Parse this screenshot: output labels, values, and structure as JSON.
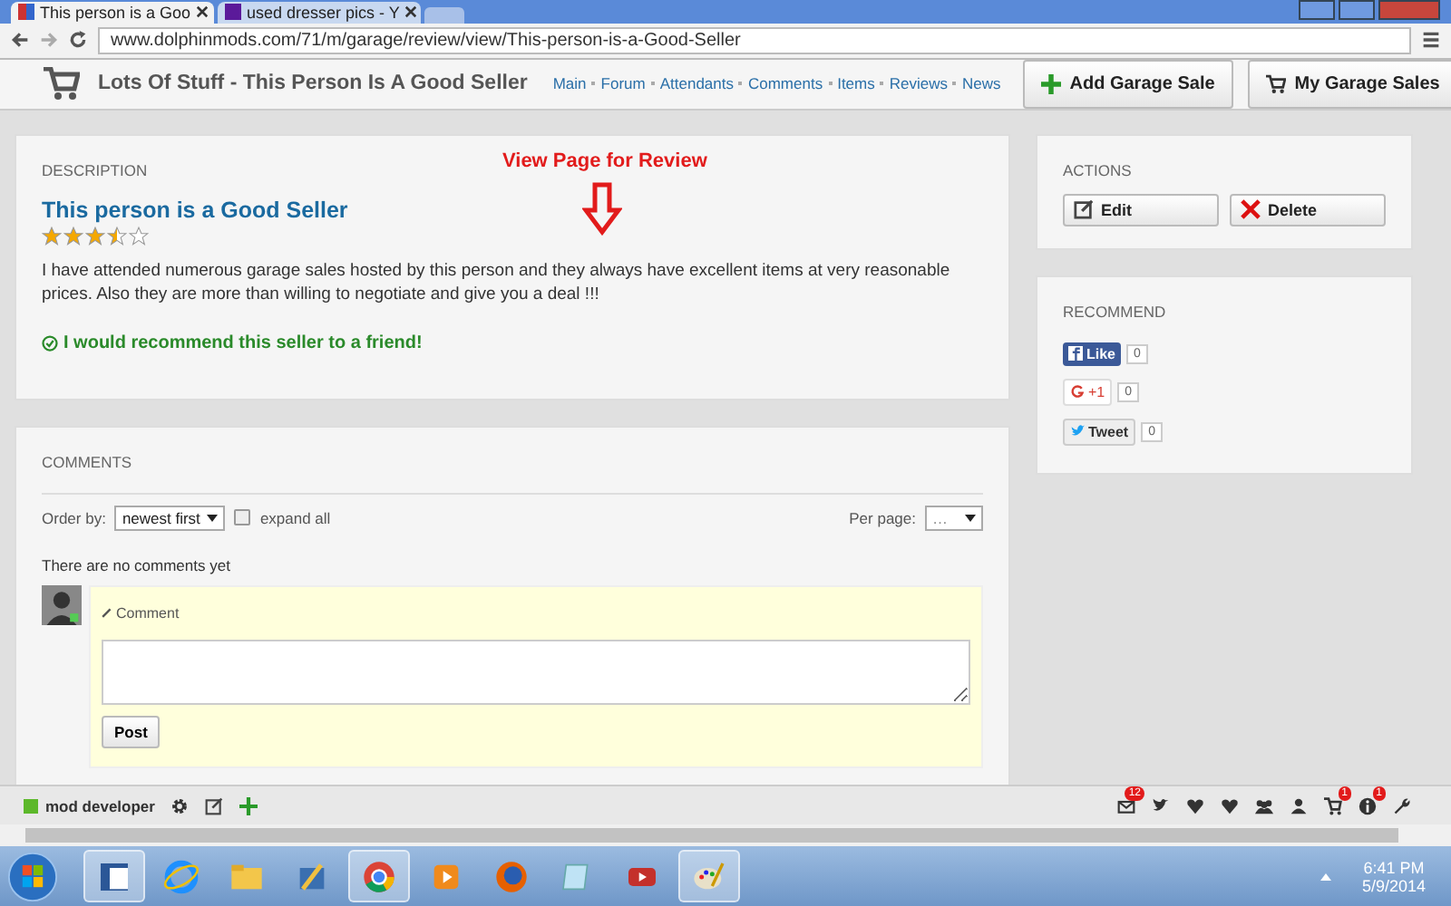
{
  "browser": {
    "tabs": [
      {
        "title": "This person is a Goo",
        "selected": true
      },
      {
        "title": "used dresser pics - Y",
        "selected": false
      }
    ],
    "url": "www.dolphinmods.com/71/m/garage/review/view/This-person-is-a-Good-Seller"
  },
  "header": {
    "title": "Lots Of Stuff - This Person Is A Good Seller",
    "nav": [
      "Main",
      "Forum",
      "Attendants",
      "Comments",
      "Items",
      "Reviews",
      "News"
    ],
    "buttons": [
      {
        "kind": "add",
        "label": "Add Garage Sale"
      },
      {
        "kind": "cart",
        "label": "My Garage Sales"
      }
    ]
  },
  "description": {
    "heading": "DESCRIPTION",
    "annotation": "View Page for Review",
    "title": "This person is a Good Seller",
    "stars": 3.5,
    "text": "I have attended numerous garage sales hosted by this person and they always have excellent items at very reasonable prices. Also they are more than willing to negotiate and give you a deal !!!",
    "recommend": "I would recommend this seller to a friend!"
  },
  "actions": {
    "heading": "ACTIONS",
    "buttons": [
      {
        "kind": "edit",
        "label": "Edit"
      },
      {
        "kind": "delete",
        "label": "Delete"
      }
    ]
  },
  "recommend": {
    "heading": "RECOMMEND",
    "social": [
      {
        "kind": "facebook",
        "label": "Like",
        "count": "0"
      },
      {
        "kind": "gplus",
        "label": "+1",
        "count": "0"
      },
      {
        "kind": "twitter",
        "label": "Tweet",
        "count": "0"
      }
    ]
  },
  "comments": {
    "heading": "COMMENTS",
    "order_label": "Order by:",
    "order_value": "newest first",
    "expand_all": {
      "label": "expand all",
      "checked": false
    },
    "per_page_label": "Per page:",
    "per_page_value": "…",
    "empty_text": "There are no comments yet",
    "comment_label": "Comment",
    "post_button": "Post"
  },
  "toolbar": {
    "user": "mod developer",
    "badges": [
      {
        "kind": "mail",
        "count": "12"
      },
      {
        "kind": "bird"
      },
      {
        "kind": "heart"
      },
      {
        "kind": "heart"
      },
      {
        "kind": "group"
      },
      {
        "kind": "person"
      },
      {
        "kind": "cart",
        "count": "1"
      },
      {
        "kind": "info",
        "count": "1"
      },
      {
        "kind": "wrench"
      }
    ]
  },
  "taskbar": {
    "time": "6:41 PM",
    "date": "5/9/2014"
  }
}
